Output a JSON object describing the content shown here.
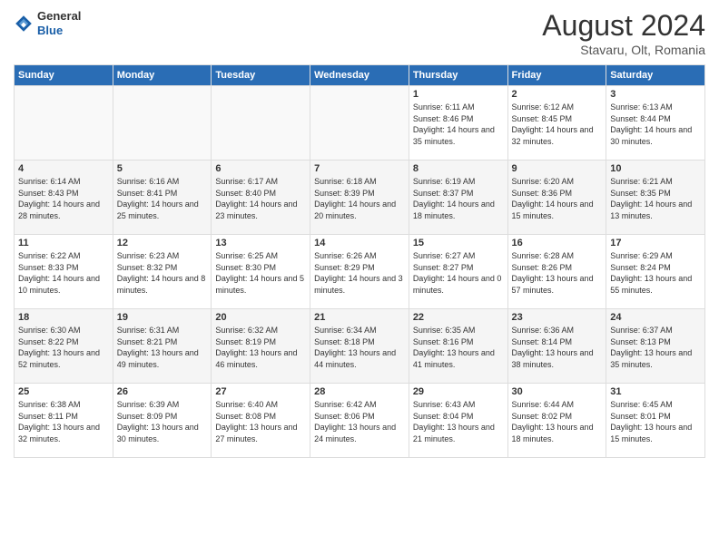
{
  "header": {
    "logo": {
      "general": "General",
      "blue": "Blue"
    },
    "title": "August 2024",
    "subtitle": "Stavaru, Olt, Romania"
  },
  "days_of_week": [
    "Sunday",
    "Monday",
    "Tuesday",
    "Wednesday",
    "Thursday",
    "Friday",
    "Saturday"
  ],
  "weeks": [
    [
      {
        "day": "",
        "info": ""
      },
      {
        "day": "",
        "info": ""
      },
      {
        "day": "",
        "info": ""
      },
      {
        "day": "",
        "info": ""
      },
      {
        "day": "1",
        "info": "Sunrise: 6:11 AM\nSunset: 8:46 PM\nDaylight: 14 hours and 35 minutes."
      },
      {
        "day": "2",
        "info": "Sunrise: 6:12 AM\nSunset: 8:45 PM\nDaylight: 14 hours and 32 minutes."
      },
      {
        "day": "3",
        "info": "Sunrise: 6:13 AM\nSunset: 8:44 PM\nDaylight: 14 hours and 30 minutes."
      }
    ],
    [
      {
        "day": "4",
        "info": "Sunrise: 6:14 AM\nSunset: 8:43 PM\nDaylight: 14 hours and 28 minutes."
      },
      {
        "day": "5",
        "info": "Sunrise: 6:16 AM\nSunset: 8:41 PM\nDaylight: 14 hours and 25 minutes."
      },
      {
        "day": "6",
        "info": "Sunrise: 6:17 AM\nSunset: 8:40 PM\nDaylight: 14 hours and 23 minutes."
      },
      {
        "day": "7",
        "info": "Sunrise: 6:18 AM\nSunset: 8:39 PM\nDaylight: 14 hours and 20 minutes."
      },
      {
        "day": "8",
        "info": "Sunrise: 6:19 AM\nSunset: 8:37 PM\nDaylight: 14 hours and 18 minutes."
      },
      {
        "day": "9",
        "info": "Sunrise: 6:20 AM\nSunset: 8:36 PM\nDaylight: 14 hours and 15 minutes."
      },
      {
        "day": "10",
        "info": "Sunrise: 6:21 AM\nSunset: 8:35 PM\nDaylight: 14 hours and 13 minutes."
      }
    ],
    [
      {
        "day": "11",
        "info": "Sunrise: 6:22 AM\nSunset: 8:33 PM\nDaylight: 14 hours and 10 minutes."
      },
      {
        "day": "12",
        "info": "Sunrise: 6:23 AM\nSunset: 8:32 PM\nDaylight: 14 hours and 8 minutes."
      },
      {
        "day": "13",
        "info": "Sunrise: 6:25 AM\nSunset: 8:30 PM\nDaylight: 14 hours and 5 minutes."
      },
      {
        "day": "14",
        "info": "Sunrise: 6:26 AM\nSunset: 8:29 PM\nDaylight: 14 hours and 3 minutes."
      },
      {
        "day": "15",
        "info": "Sunrise: 6:27 AM\nSunset: 8:27 PM\nDaylight: 14 hours and 0 minutes."
      },
      {
        "day": "16",
        "info": "Sunrise: 6:28 AM\nSunset: 8:26 PM\nDaylight: 13 hours and 57 minutes."
      },
      {
        "day": "17",
        "info": "Sunrise: 6:29 AM\nSunset: 8:24 PM\nDaylight: 13 hours and 55 minutes."
      }
    ],
    [
      {
        "day": "18",
        "info": "Sunrise: 6:30 AM\nSunset: 8:22 PM\nDaylight: 13 hours and 52 minutes."
      },
      {
        "day": "19",
        "info": "Sunrise: 6:31 AM\nSunset: 8:21 PM\nDaylight: 13 hours and 49 minutes."
      },
      {
        "day": "20",
        "info": "Sunrise: 6:32 AM\nSunset: 8:19 PM\nDaylight: 13 hours and 46 minutes."
      },
      {
        "day": "21",
        "info": "Sunrise: 6:34 AM\nSunset: 8:18 PM\nDaylight: 13 hours and 44 minutes."
      },
      {
        "day": "22",
        "info": "Sunrise: 6:35 AM\nSunset: 8:16 PM\nDaylight: 13 hours and 41 minutes."
      },
      {
        "day": "23",
        "info": "Sunrise: 6:36 AM\nSunset: 8:14 PM\nDaylight: 13 hours and 38 minutes."
      },
      {
        "day": "24",
        "info": "Sunrise: 6:37 AM\nSunset: 8:13 PM\nDaylight: 13 hours and 35 minutes."
      }
    ],
    [
      {
        "day": "25",
        "info": "Sunrise: 6:38 AM\nSunset: 8:11 PM\nDaylight: 13 hours and 32 minutes."
      },
      {
        "day": "26",
        "info": "Sunrise: 6:39 AM\nSunset: 8:09 PM\nDaylight: 13 hours and 30 minutes."
      },
      {
        "day": "27",
        "info": "Sunrise: 6:40 AM\nSunset: 8:08 PM\nDaylight: 13 hours and 27 minutes."
      },
      {
        "day": "28",
        "info": "Sunrise: 6:42 AM\nSunset: 8:06 PM\nDaylight: 13 hours and 24 minutes."
      },
      {
        "day": "29",
        "info": "Sunrise: 6:43 AM\nSunset: 8:04 PM\nDaylight: 13 hours and 21 minutes."
      },
      {
        "day": "30",
        "info": "Sunrise: 6:44 AM\nSunset: 8:02 PM\nDaylight: 13 hours and 18 minutes."
      },
      {
        "day": "31",
        "info": "Sunrise: 6:45 AM\nSunset: 8:01 PM\nDaylight: 13 hours and 15 minutes."
      }
    ]
  ]
}
